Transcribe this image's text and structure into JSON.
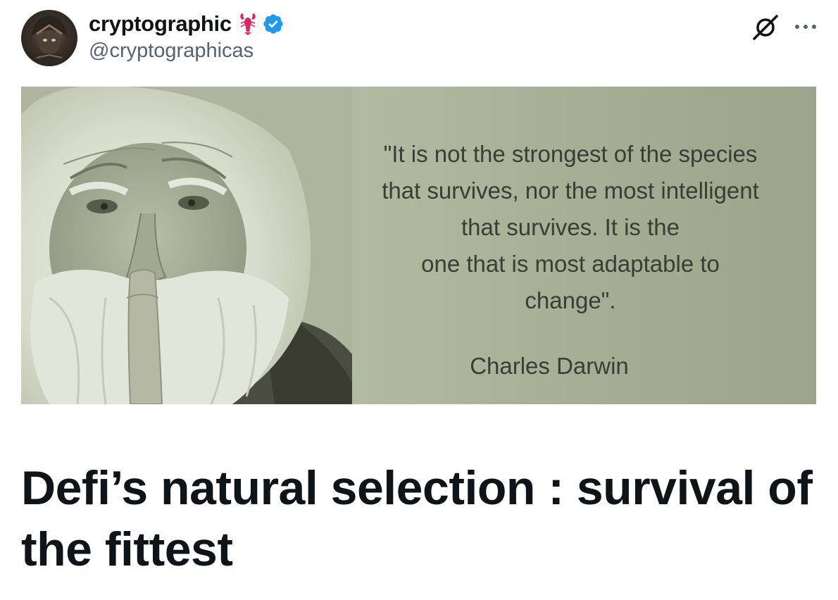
{
  "tweet": {
    "author": {
      "display_name": "cryptographic",
      "handle": "@cryptographicas",
      "emoji_icon": "lobster-icon",
      "verified_icon": "verified-badge-icon"
    },
    "actions": {
      "grok_icon": "grok-icon",
      "more_icon": "more-options-icon"
    },
    "media": {
      "quote_lines": [
        "\"It is not the strongest of the species",
        "that survives, nor the most intelligent",
        "that survives. It is the",
        "one that is most adaptable to",
        "change\"."
      ],
      "attribution": "Charles Darwin"
    },
    "article": {
      "title": "Defi’s natural selection : survival of the fittest"
    }
  },
  "colors": {
    "text_primary": "#0f1419",
    "text_secondary": "#536471",
    "verified_blue": "#1d9bf0",
    "lobster_red": "#e0245e"
  }
}
